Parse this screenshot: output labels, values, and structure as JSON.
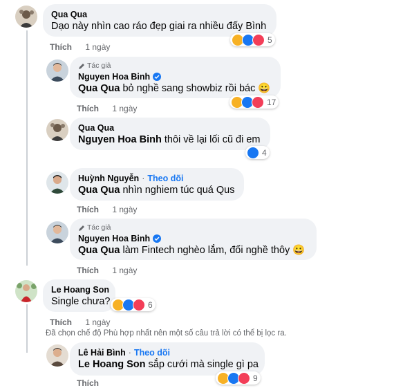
{
  "comments": [
    {
      "author": "Qua Qua",
      "text": "Dạo này nhìn cao ráo đẹp giai ra nhiều đấy Bình",
      "like_label": "Thích",
      "time": "1 ngày",
      "reaction_count": "5"
    },
    {
      "badge": "Tác giả",
      "author": "Nguyen Hoa Binh",
      "mention": "Qua Qua",
      "text": "bỏ nghề sang showbiz rồi bác",
      "like_label": "Thích",
      "time": "1 ngày",
      "reaction_count": "17"
    },
    {
      "author": "Qua Qua",
      "mention": "Nguyen Hoa Binh",
      "text": "thôi về lại lối cũ đi em",
      "like_label": "Thích",
      "time": "1 ngày",
      "reaction_count": "4"
    },
    {
      "author": "Huỳnh Nguyễn",
      "dot": "·",
      "follow": "Theo dõi",
      "mention": "Qua Qua",
      "text": "nhìn nghiem túc quá Qus",
      "like_label": "Thích",
      "time": "1 ngày"
    },
    {
      "badge": "Tác giả",
      "author": "Nguyen Hoa Binh",
      "mention": "Qua Qua",
      "text": "làm Fintech nghèo lắm, đổi nghề thôy",
      "like_label": "Thích",
      "time": "1 ngày"
    },
    {
      "author": "Le Hoang Son",
      "text": "Single chưa?",
      "like_label": "Thích",
      "time": "1 ngày",
      "reaction_count": "6"
    },
    {
      "author": "Lê Hải Bình",
      "dot": "·",
      "follow": "Theo dõi",
      "mention": "Le Hoang Son",
      "text": "sắp cưới mà single gì pa",
      "like_label": "Thích",
      "reaction_count": "9"
    }
  ],
  "filter_note": "Đã chọn chế độ Phù hợp nhất nên một số câu trả lời có thể bị lọc ra.",
  "emojis": {
    "grin": "😀"
  },
  "icons": {
    "author_badge": "pencil-icon",
    "verified": "verified-badge-icon",
    "reactions": [
      "haha-reaction-icon",
      "like-reaction-icon",
      "love-reaction-icon"
    ]
  },
  "colors": {
    "bubble": "#f0f2f5",
    "link": "#1877f2",
    "muted": "#65676b",
    "haha": "#f7b125",
    "like": "#1877f2",
    "love": "#f33e58"
  }
}
